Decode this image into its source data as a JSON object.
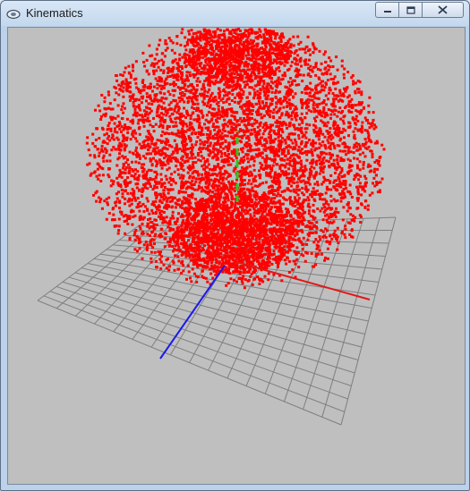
{
  "window": {
    "title": "Kinematics",
    "icon": "app-icon"
  },
  "controls": {
    "minimize_icon": "minimize-icon",
    "maximize_icon": "maximize-icon",
    "close_icon": "close-icon"
  },
  "viewport": {
    "background_color": "#bfbfbf",
    "grid_color": "#7f7f7f",
    "point_color": "#ff0000",
    "x_axis_color": "#e01818",
    "y_axis_color": "#22cc22",
    "z_axis_color": "#1a1aee"
  }
}
